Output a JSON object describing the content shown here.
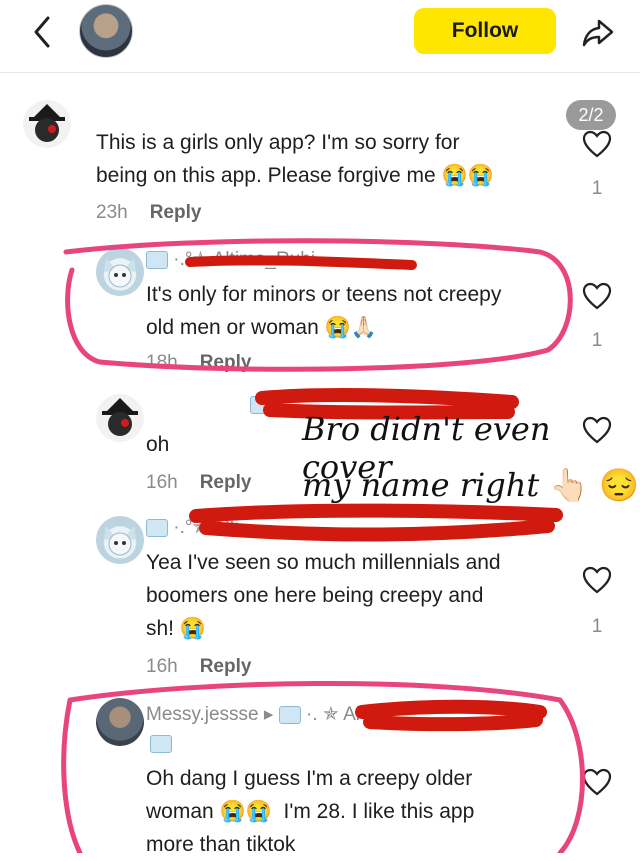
{
  "header": {
    "follow_label": "Follow"
  },
  "pager": "2/2",
  "comments": [
    {
      "text_line1": "This is a girls only app? I'm so sorry for",
      "text_line2": "being on this app. Please forgive me",
      "emoji": "😭😭",
      "time": "23h",
      "reply": "Reply",
      "likes": "1"
    },
    {
      "username": "Altima_Rubi",
      "text_line1": "It's only for minors or teens not creepy",
      "text_line2": "old men or woman",
      "emoji": "😭🙏🏻",
      "time": "18h",
      "reply": "Reply",
      "likes": "1"
    },
    {
      "text": "oh",
      "time": "16h",
      "reply": "Reply"
    },
    {
      "username": "Alti",
      "text_line1": "Yea I've seen so much millennials and",
      "text_line2": "boomers one here being creepy and",
      "text_line3": "sh!",
      "emoji": "😭",
      "time": "16h",
      "reply": "Reply",
      "likes": "1"
    },
    {
      "username": "Messy.jessse",
      "reply_to": "Al",
      "text_line1": "Oh dang I guess I'm a creepy older",
      "text_line2a": "woman",
      "emoji": "😭😭",
      "text_line2b": "I'm 28. I like this app",
      "text_line3": "more than tiktok"
    }
  ],
  "annotation": {
    "line1": "Bro didn't even cover",
    "line2": "my name right",
    "emoji": "👆🏻 😔"
  },
  "colors": {
    "follow_bg": "#ffe600",
    "circle_pink": "#e8447f",
    "redact_red": "#d11a0f"
  }
}
